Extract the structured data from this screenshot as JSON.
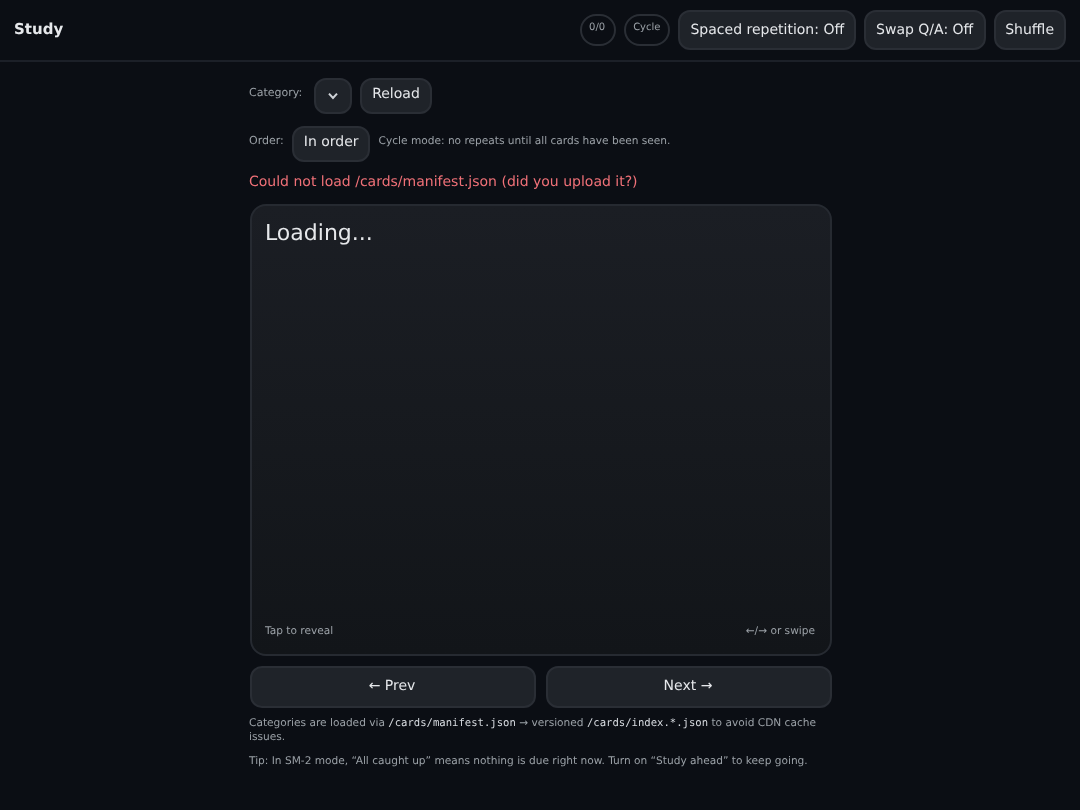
{
  "header": {
    "title": "Study",
    "badges": [
      "0/0",
      "Cycle"
    ],
    "buttons": [
      "Spaced repetition: Off",
      "Swap Q/A: Off",
      "Shuffle"
    ]
  },
  "category": {
    "label": "Category:",
    "reload": "Reload"
  },
  "order": {
    "label": "Order:",
    "button": "In order",
    "note": "Cycle mode: no repeats until all cards have been seen."
  },
  "error": "Could not load /cards/manifest.json (did you upload it?)",
  "card": {
    "text": "Loading...",
    "hint_left": "Tap to reveal",
    "hint_right": "←/→ or swipe"
  },
  "nav": [
    "← Prev",
    "Next →"
  ],
  "notes": [
    {
      "segments": [
        {
          "kind": "text",
          "text": "Categories are loaded via "
        },
        {
          "kind": "code",
          "text": "/cards/manifest.json"
        },
        {
          "kind": "text",
          "text": " → versioned "
        },
        {
          "kind": "code",
          "text": "/cards/index.*.json"
        },
        {
          "kind": "text",
          "text": " to avoid CDN cache issues."
        }
      ]
    },
    {
      "segments": [
        {
          "kind": "text",
          "text": "Tip: In SM-2 mode, “All caught up” means nothing is due right now. Turn on “Study ahead” to keep going."
        }
      ]
    }
  ]
}
